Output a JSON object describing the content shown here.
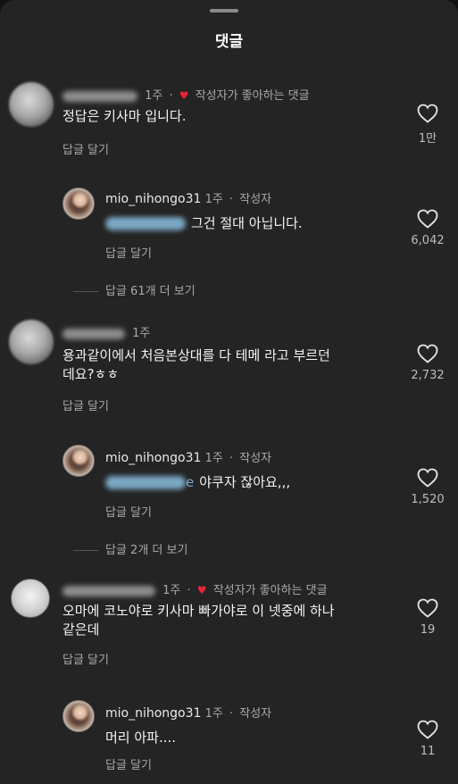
{
  "sheet": {
    "title": "댓글"
  },
  "labels": {
    "reply": "답글 달기",
    "author": "작성자",
    "creator_liked": "작성자가 좋아하는 댓글"
  },
  "comments": [
    {
      "time": "1주",
      "text": "정답은 키사마 입니다.",
      "likes": "1만",
      "reply": {
        "username": "mio_nihongo31",
        "time": "1주",
        "text": "그건 절대 아닙니다.",
        "likes": "6,042"
      },
      "more_replies": "답글 61개 더 보기"
    },
    {
      "time": "1주",
      "text_line1": "용과같이에서 처음본상대를 다 테메 라고 부르던",
      "text_line2": "데요?ㅎㅎ",
      "likes": "2,732",
      "reply": {
        "username": "mio_nihongo31",
        "time": "1주",
        "mention_suffix": "e",
        "text": "야쿠자 잖아요,,,",
        "likes": "1,520"
      },
      "more_replies": "답글 2개 더 보기"
    },
    {
      "time": "1주",
      "text_line1": "오마에 코노야로 키사마 빠가야로 이 넷중에 하나",
      "text_line2": "같은데",
      "likes": "19",
      "reply": {
        "username": "mio_nihongo31",
        "time": "1주",
        "text": "머리 아파....",
        "likes": "11"
      }
    }
  ]
}
